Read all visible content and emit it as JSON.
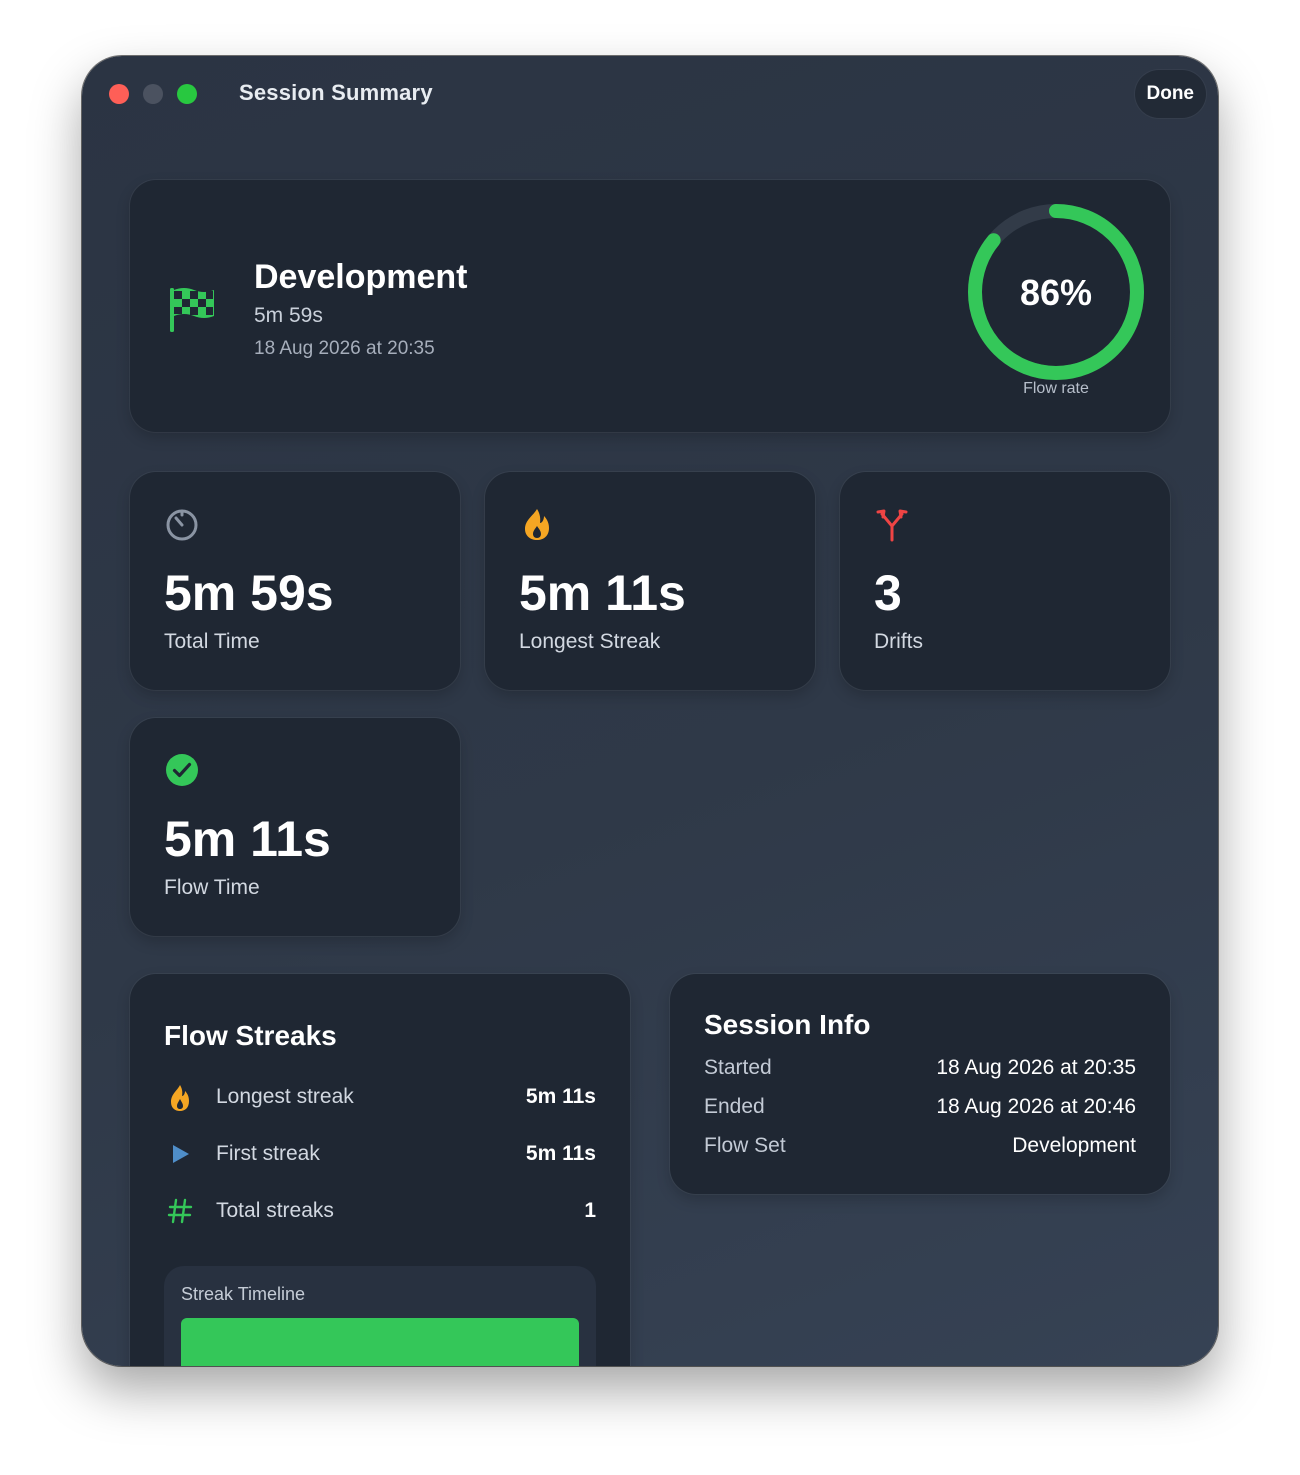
{
  "window": {
    "title": "Session Summary",
    "done_label": "Done"
  },
  "summary": {
    "icon": "checkered-flag-icon",
    "name": "Development",
    "duration": "5m 59s",
    "date": "18 Aug 2026 at 20:35",
    "flow_rate_label": "86%",
    "flow_rate_value": 0.86,
    "flow_rate_caption": "Flow rate",
    "accent_color": "#34c759"
  },
  "stats": [
    {
      "icon": "timer-icon",
      "value": "5m 59s",
      "label": "Total Time",
      "icon_color": "#8a94a3"
    },
    {
      "icon": "flame-icon",
      "value": "5m 11s",
      "label": "Longest Streak",
      "icon_color": "#f5a623"
    },
    {
      "icon": "branch-arrow-icon",
      "value": "3",
      "label": "Drifts",
      "icon_color": "#ef4444"
    },
    {
      "icon": "checkmark-circle-icon",
      "value": "5m 11s",
      "label": "Flow Time",
      "icon_color": "#34c759"
    }
  ],
  "flow_streaks": {
    "title": "Flow Streaks",
    "rows": [
      {
        "icon": "flame-icon",
        "label": "Longest streak",
        "value": "5m 11s"
      },
      {
        "icon": "play-icon",
        "label": "First streak",
        "value": "5m 11s"
      },
      {
        "icon": "hash-icon",
        "label": "Total streaks",
        "value": "1"
      }
    ],
    "timeline_label": "Streak Timeline"
  },
  "session_info": {
    "title": "Session Info",
    "rows": [
      {
        "label": "Started",
        "value": "18 Aug 2026 at 20:35"
      },
      {
        "label": "Ended",
        "value": "18 Aug 2026 at 20:46"
      },
      {
        "label": "Flow Set",
        "value": "Development"
      }
    ]
  }
}
